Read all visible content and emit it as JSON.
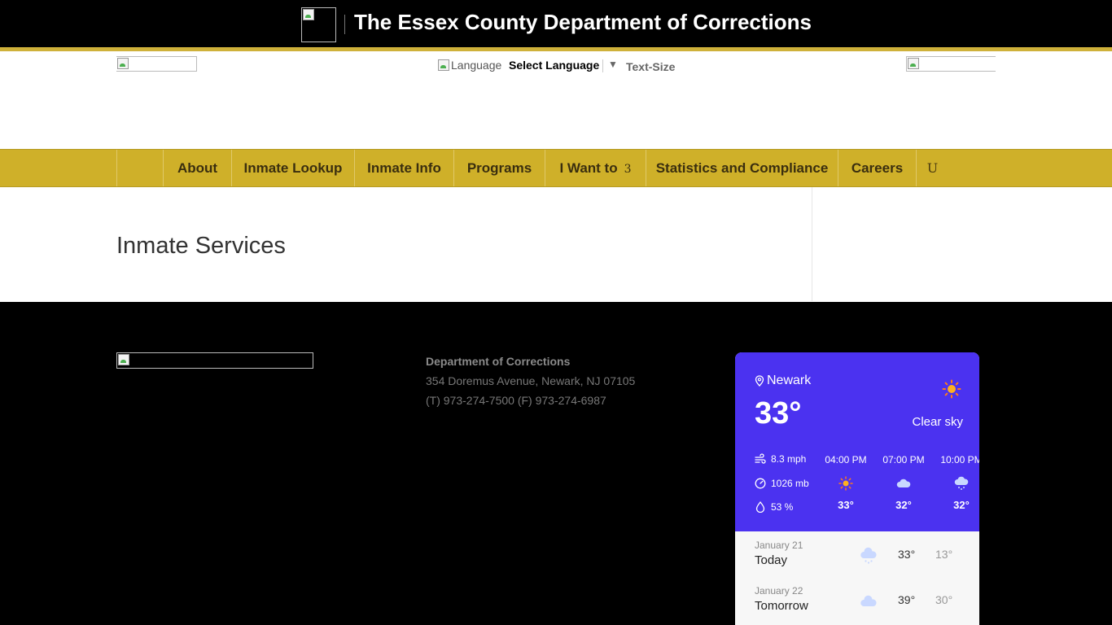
{
  "banner": {
    "title": "The Essex County Department of Corrections",
    "logo_icon": "broken-image-icon"
  },
  "header": {
    "language_alt": "Language",
    "language_select_label": "Select Language",
    "language_arrow": "▼",
    "text_size_label": "Text-Size"
  },
  "nav": {
    "items": [
      {
        "label": "About"
      },
      {
        "label": "Inmate Lookup"
      },
      {
        "label": "Inmate Info"
      },
      {
        "label": "Programs"
      },
      {
        "label": "I Want to",
        "caret": "3"
      },
      {
        "label": "Statistics and Compliance"
      },
      {
        "label": "Careers"
      }
    ],
    "trailing_glyph": "U"
  },
  "main": {
    "title": "Inmate Services"
  },
  "footer": {
    "department": "Department of Corrections",
    "address": "354 Doremus Avenue, Newark, NJ 07105",
    "phone": "(T) 973-274-7500 (F) 973-274-6987"
  },
  "weather": {
    "city": "Newark",
    "temperature": "33°",
    "condition": "Clear sky",
    "wind": "8.3 mph",
    "pressure": "1026 mb",
    "humidity": "53 %",
    "hourly": [
      {
        "time": "04:00 PM",
        "icon": "sun-icon",
        "temp": "33°"
      },
      {
        "time": "07:00 PM",
        "icon": "cloud-icon",
        "temp": "32°"
      },
      {
        "time": "10:00 PM",
        "icon": "snow-cloud-icon",
        "temp": "32°"
      }
    ],
    "daily": [
      {
        "date": "January 21",
        "name": "Today",
        "icon": "snow-cloud-icon",
        "high": "33°",
        "low": "13°"
      },
      {
        "date": "January 22",
        "name": "Tomorrow",
        "icon": "cloud-icon",
        "high": "39°",
        "low": "30°"
      }
    ],
    "colors": {
      "panel": "#4b32f0",
      "sun": "#ffb020",
      "cloud": "#c9d8ff"
    }
  },
  "colors": {
    "nav_gold": "#cfb029",
    "banner_black": "#000000",
    "accent_line": "#cfb13a"
  }
}
